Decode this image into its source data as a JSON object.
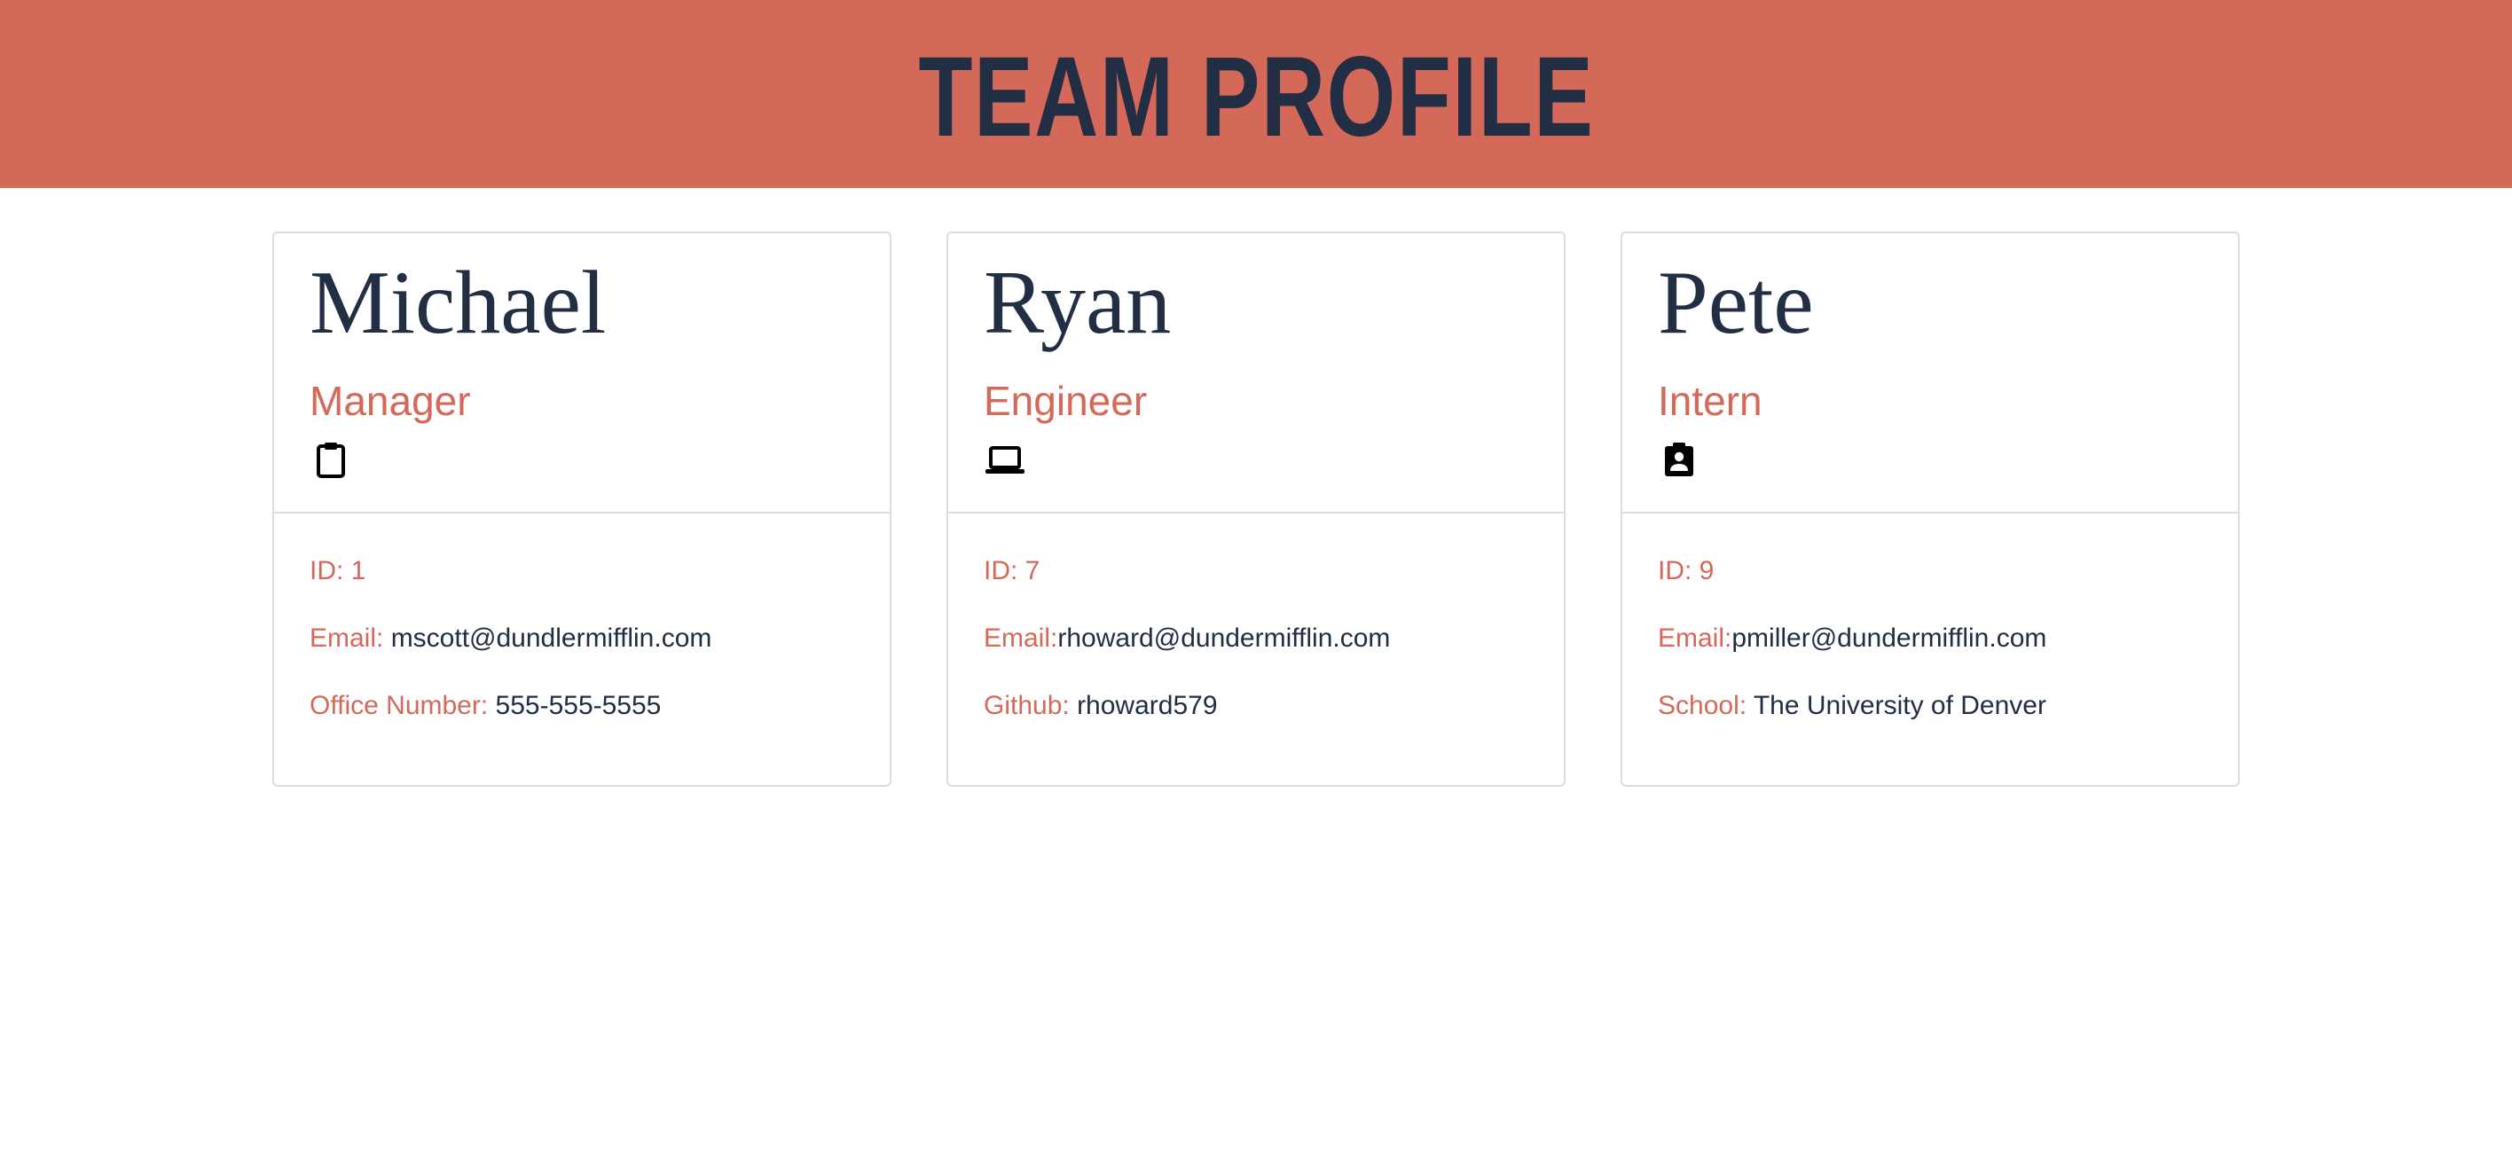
{
  "header": {
    "title": "TEAM PROFILE"
  },
  "colors": {
    "accent": "#d56959",
    "text": "#222e44",
    "border": "#dcdcdc"
  },
  "cards": [
    {
      "name": "Michael",
      "role": "Manager",
      "icon": "clipboard-icon",
      "id_label": "ID: 1",
      "email_label": "Email: ",
      "email": "mscott@dundlermifflin.com",
      "extra_label": "Office Number: ",
      "extra_value": "555-555-5555"
    },
    {
      "name": "Ryan",
      "role": "Engineer",
      "icon": "laptop-icon",
      "id_label": "ID: 7",
      "email_label": "Email:",
      "email": "rhoward@dundermifflin.com",
      "extra_label": "Github: ",
      "extra_value": "rhoward579"
    },
    {
      "name": "Pete",
      "role": "Intern",
      "icon": "assignment-ind-icon",
      "id_label": "ID: 9",
      "email_label": "Email:",
      "email": "pmiller@dundermifflin.com",
      "extra_label": "School: ",
      "extra_value": "The University of Denver"
    }
  ]
}
